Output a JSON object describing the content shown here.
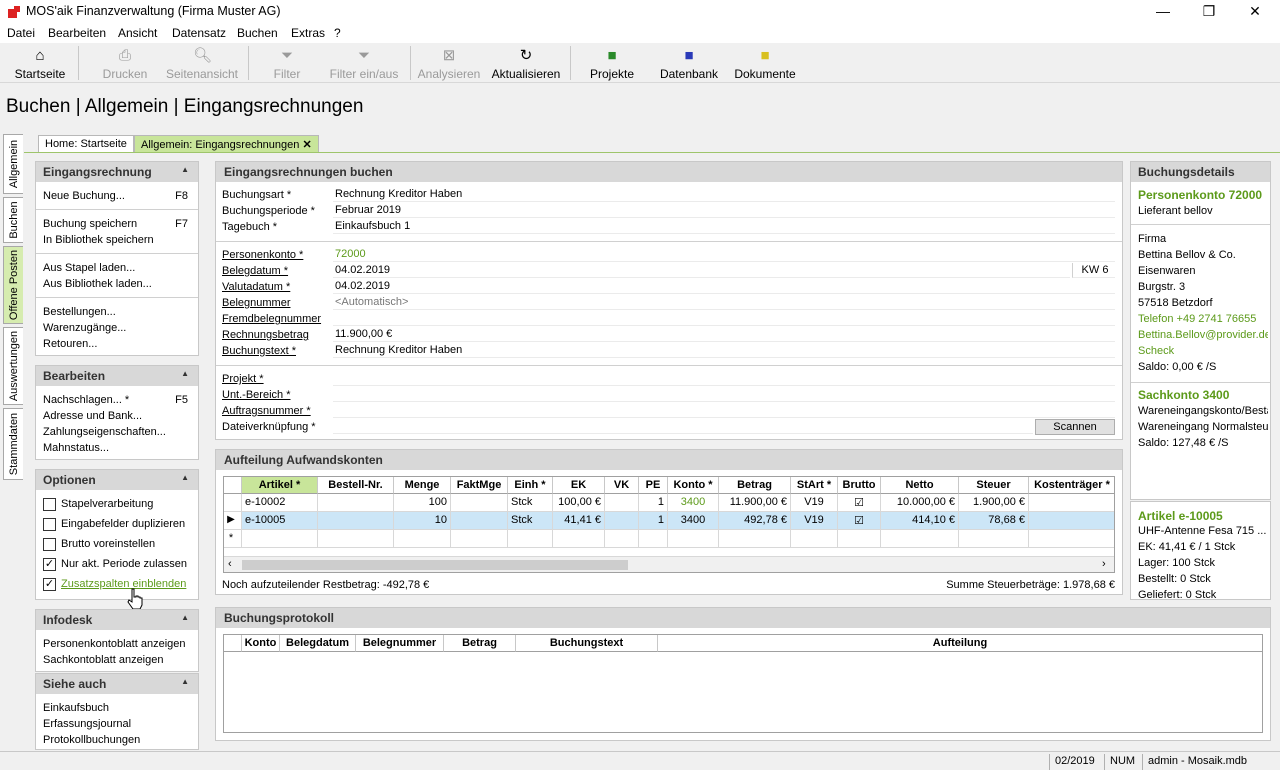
{
  "window": {
    "title": "MOS'aik Finanzverwaltung (Firma Muster AG)",
    "minimize": "—",
    "maximize": "❐",
    "close": "✕"
  },
  "menu": [
    "Datei",
    "Bearbeiten",
    "Ansicht",
    "Datensatz",
    "Buchen",
    "Extras",
    "?"
  ],
  "toolbar": {
    "startseite": "Startseite",
    "drucken": "Drucken",
    "seitenansicht": "Seitenansicht",
    "filter": "Filter",
    "filter_ein_aus": "Filter ein/aus",
    "analysieren": "Analysieren",
    "aktualisieren": "Aktualisieren",
    "projekte": "Projekte",
    "datenbank": "Datenbank",
    "dokumente": "Dokumente"
  },
  "heading": "Buchen | Allgemein | Eingangsrechnungen",
  "vtabs": [
    "Allgemein",
    "Buchen",
    "Offene Posten",
    "Auswertungen",
    "Stammdaten"
  ],
  "doctabs": {
    "home": "Home: Startseite",
    "current": "Allgemein: Eingangsrechnungen",
    "close": "✕"
  },
  "left": {
    "eingangsrechnung": {
      "title": "Eingangsrechnung",
      "neue_buchung": "Neue Buchung...",
      "neue_key": "F8",
      "speichern": "Buchung speichern",
      "speichern_key": "F7",
      "bibliothek_speichern": "In Bibliothek speichern",
      "stapel_laden": "Aus Stapel laden...",
      "bibliothek_laden": "Aus Bibliothek laden...",
      "bestellungen": "Bestellungen...",
      "warenzugaenge": "Warenzugänge...",
      "retouren": "Retouren..."
    },
    "bearbeiten": {
      "title": "Bearbeiten",
      "nachschlagen": "Nachschlagen... *",
      "nachschlagen_key": "F5",
      "adresse": "Adresse und Bank...",
      "zahlung": "Zahlungseigenschaften...",
      "mahnstatus": "Mahnstatus..."
    },
    "optionen": {
      "title": "Optionen",
      "stapel": "Stapelverarbeitung",
      "duplizieren": "Eingabefelder duplizieren",
      "brutto": "Brutto voreinstellen",
      "periode": "Nur akt. Periode zulassen",
      "zusatz": "Zusatzspalten einblenden",
      "check": "✓"
    },
    "infodesk": {
      "title": "Infodesk",
      "personen": "Personenkontoblatt anzeigen",
      "sach": "Sachkontoblatt anzeigen"
    },
    "sieheauch": {
      "title": "Siehe auch",
      "einkaufsbuch": "Einkaufsbuch",
      "erfassung": "Erfassungsjournal",
      "protokoll": "Protokollbuchungen"
    }
  },
  "form": {
    "title": "Eingangsrechnungen buchen",
    "labels": {
      "buchungsart": "Buchungsart *",
      "buchungsperiode": "Buchungsperiode *",
      "tagebuch": "Tagebuch *",
      "personenkonto": "Personenkonto *",
      "belegdatum": "Belegdatum *",
      "valutadatum": "Valutadatum *",
      "belegnummer": "Belegnummer",
      "fremdbelegnummer": "Fremdbelegnummer",
      "rechnungsbetrag": "Rechnungsbetrag",
      "buchungstext": "Buchungstext *",
      "projekt": "Projekt *",
      "unt_bereich": "Unt.-Bereich *",
      "auftragsnummer": "Auftragsnummer *",
      "dateiverknuepfung": "Dateiverknüpfung *"
    },
    "values": {
      "buchungsart": "Rechnung Kreditor Haben",
      "buchungsperiode": "Februar 2019",
      "tagebuch": "Einkaufsbuch 1",
      "personenkonto": "72000",
      "belegdatum": "04.02.2019",
      "kw": "KW 6",
      "valutadatum": "04.02.2019",
      "belegnummer": "<Automatisch>",
      "fremdbelegnummer": "",
      "rechnungsbetrag": "11.900,00 €",
      "buchungstext": "Rechnung Kreditor Haben",
      "projekt": "",
      "unt_bereich": "",
      "auftragsnummer": "",
      "dateiverknuepfung": ""
    },
    "scannen": "Scannen"
  },
  "aufteilung": {
    "title": "Aufteilung Aufwandskonten",
    "columns": [
      "Artikel *",
      "Bestell-Nr.",
      "Menge",
      "FaktMge",
      "Einh *",
      "EK",
      "VK",
      "PE",
      "Konto *",
      "Betrag",
      "StArt *",
      "Brutto",
      "Netto",
      "Steuer",
      "Kostenträger *"
    ],
    "rows": [
      {
        "artikel": "e-10002",
        "bestell": "",
        "menge": "100",
        "faktmge": "",
        "einh": "Stck",
        "ek": "100,00 €",
        "vk": "",
        "pe": "1",
        "konto": "3400",
        "betrag": "11.900,00 €",
        "start": "V19",
        "brutto": "☑",
        "netto": "10.000,00 €",
        "steuer": "1.900,00 €",
        "kost": ""
      },
      {
        "artikel": "e-10005",
        "bestell": "",
        "menge": "10",
        "faktmge": "",
        "einh": "Stck",
        "ek": "41,41 €",
        "vk": "",
        "pe": "1",
        "konto": "3400",
        "betrag": "492,78 €",
        "start": "V19",
        "brutto": "☑",
        "netto": "414,10 €",
        "steuer": "78,68 €",
        "kost": ""
      }
    ],
    "new_row_marker": "*",
    "current_row_marker": "▶",
    "restbetrag": "Noch aufzuteilender Restbetrag: -492,78 €",
    "summe": "Summe Steuerbeträge: 1.978,68 €"
  },
  "protokoll": {
    "title": "Buchungsprotokoll",
    "columns": [
      "Konto",
      "Belegdatum",
      "Belegnummer",
      "Betrag",
      "Buchungstext",
      "Aufteilung"
    ]
  },
  "details": {
    "title": "Buchungsdetails",
    "personen_title": "Personenkonto 72000",
    "lieferant": "Lieferant bellov",
    "firma": "Firma",
    "name": "Bettina Bellov & Co.",
    "ort1": "Eisenwaren",
    "strasse": "Burgstr. 3",
    "plzort": "57518 Betzdorf",
    "telefon": "Telefon +49 2741 76655",
    "email": "Bettina.Bellov@provider.de",
    "scheck": "Scheck",
    "saldo1": "Saldo: 0,00 € /S",
    "sach_title": "Sachkonto 3400",
    "sach1": "Wareneingangskonto/Bestand",
    "sach2": "Wareneingang Normalsteuer",
    "saldo2": "Saldo: 127,48 € /S",
    "artikel_title": "Artikel e-10005",
    "art1": "UHF-Antenne Fesa 715 ...",
    "art2": "EK: 41,41 € / 1 Stck",
    "art3": "Lager: 100 Stck",
    "art4": "Bestellt: 0 Stck",
    "art5": "Geliefert: 0 Stck"
  },
  "status": {
    "periode": "02/2019",
    "num": "NUM",
    "user": "admin - Mosaik.mdb"
  }
}
